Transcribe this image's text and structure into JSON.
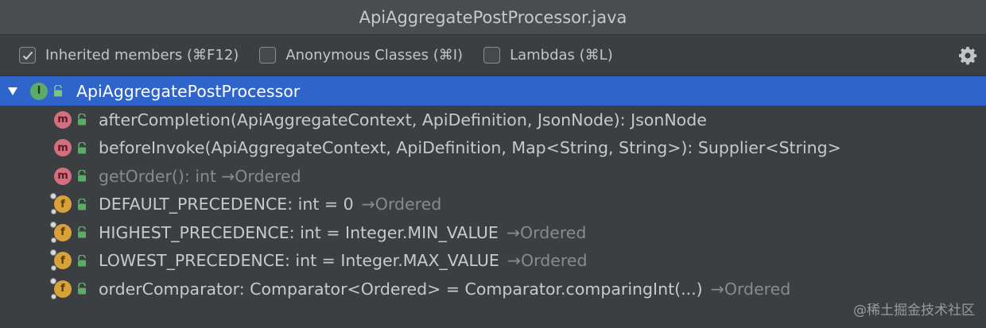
{
  "window": {
    "title": "ApiAggregatePostProcessor.java"
  },
  "toolbar": {
    "inherited_members": {
      "label": "Inherited members (⌘F12)",
      "checked": true
    },
    "anonymous_classes": {
      "label": "Anonymous Classes (⌘I)",
      "checked": false
    },
    "lambdas": {
      "label": "Lambdas (⌘L)",
      "checked": false
    },
    "settings_icon": "gear-icon"
  },
  "tree": {
    "root": {
      "icon": "interface-icon",
      "icon_letter": "I",
      "label": "ApiAggregatePostProcessor"
    },
    "items": [
      {
        "kind": "method",
        "icon_letter": "m",
        "text": "afterCompletion(ApiAggregateContext, ApiDefinition, JsonNode): JsonNode",
        "origin": "",
        "inherited": false
      },
      {
        "kind": "method",
        "icon_letter": "m",
        "text": "beforeInvoke(ApiAggregateContext, ApiDefinition, Map<String, String>): Supplier<String>",
        "origin": "",
        "inherited": false
      },
      {
        "kind": "method",
        "icon_letter": "m",
        "text": "getOrder(): int",
        "origin": "→Ordered",
        "inherited": true
      },
      {
        "kind": "field",
        "icon_letter": "f",
        "text": "DEFAULT_PRECEDENCE: int = 0",
        "origin": "→Ordered",
        "inherited": false
      },
      {
        "kind": "field",
        "icon_letter": "f",
        "text": "HIGHEST_PRECEDENCE: int = Integer.MIN_VALUE",
        "origin": "→Ordered",
        "inherited": false
      },
      {
        "kind": "field",
        "icon_letter": "f",
        "text": "LOWEST_PRECEDENCE: int = Integer.MAX_VALUE",
        "origin": "→Ordered",
        "inherited": false
      },
      {
        "kind": "field",
        "icon_letter": "f",
        "text": "orderComparator: Comparator<Ordered> = Comparator.comparingInt(...)",
        "origin": "→Ordered",
        "inherited": false
      }
    ]
  },
  "watermark": "@稀土掘金技术社区",
  "colors": {
    "background": "#3c3f41",
    "selection": "#2f65ca",
    "method_icon": "#d3707f",
    "field_icon": "#d9a13a",
    "interface_icon": "#5eaa69"
  }
}
